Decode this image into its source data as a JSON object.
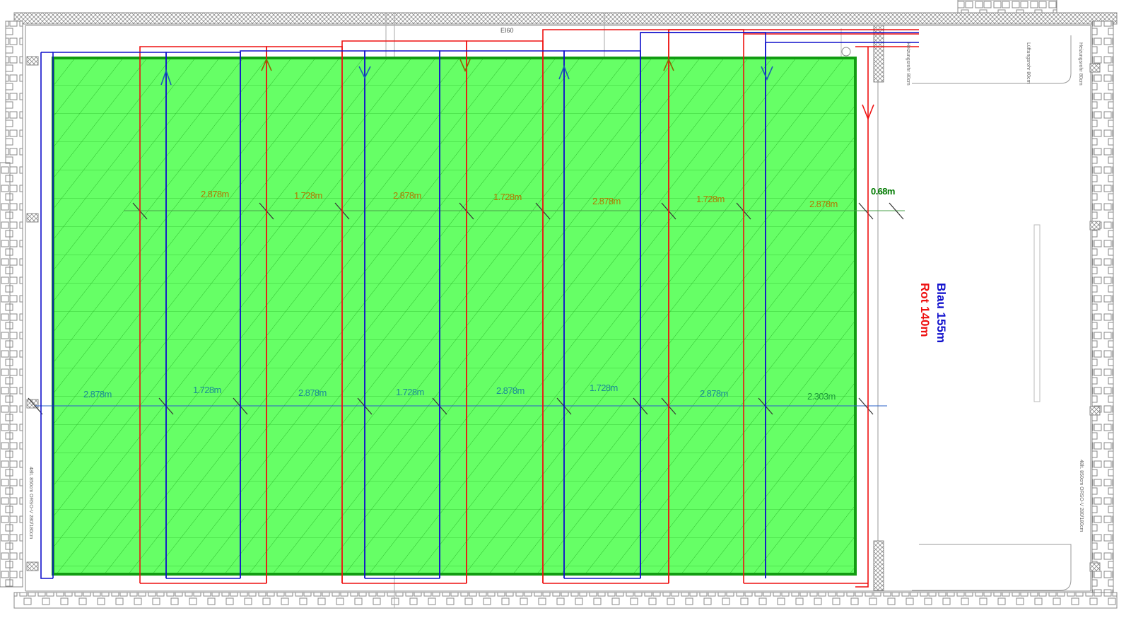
{
  "colors": {
    "floor": "#66ff66",
    "floor_border": "#129c12",
    "hatch": "#22b022",
    "blue": "#1010cc",
    "red": "#ee1111",
    "top_dim": "#b07800",
    "bottom_dim": "#1a8a96",
    "green_dim": "#007a00",
    "wall": "#909090"
  },
  "labels": {
    "door_label": "EI60",
    "legend_blue": "Blau 155m",
    "legend_red": "Rot 140m",
    "side_gap": "0.68m",
    "left_wall_note": "48lt. 850cm ORSO-V 280/180cm",
    "right_wall_note": "48lt. 850cm ORSO-V 280/180cm",
    "tiny_1": "Lüftungsrohr 80cm",
    "tiny_2": "Heizungsrohr 80cm",
    "tiny_3": "Heizungsrohr 80cm"
  },
  "top_dimensions": [
    "2.878m",
    "1.728m",
    "2.878m",
    "1.728m",
    "2.878m",
    "1.728m",
    "2.878m"
  ],
  "bottom_dimensions": [
    "2.878m",
    "1.728m",
    "2.878m",
    "1.728m",
    "2.878m",
    "1.728m",
    "2.878m",
    "2.303m"
  ]
}
